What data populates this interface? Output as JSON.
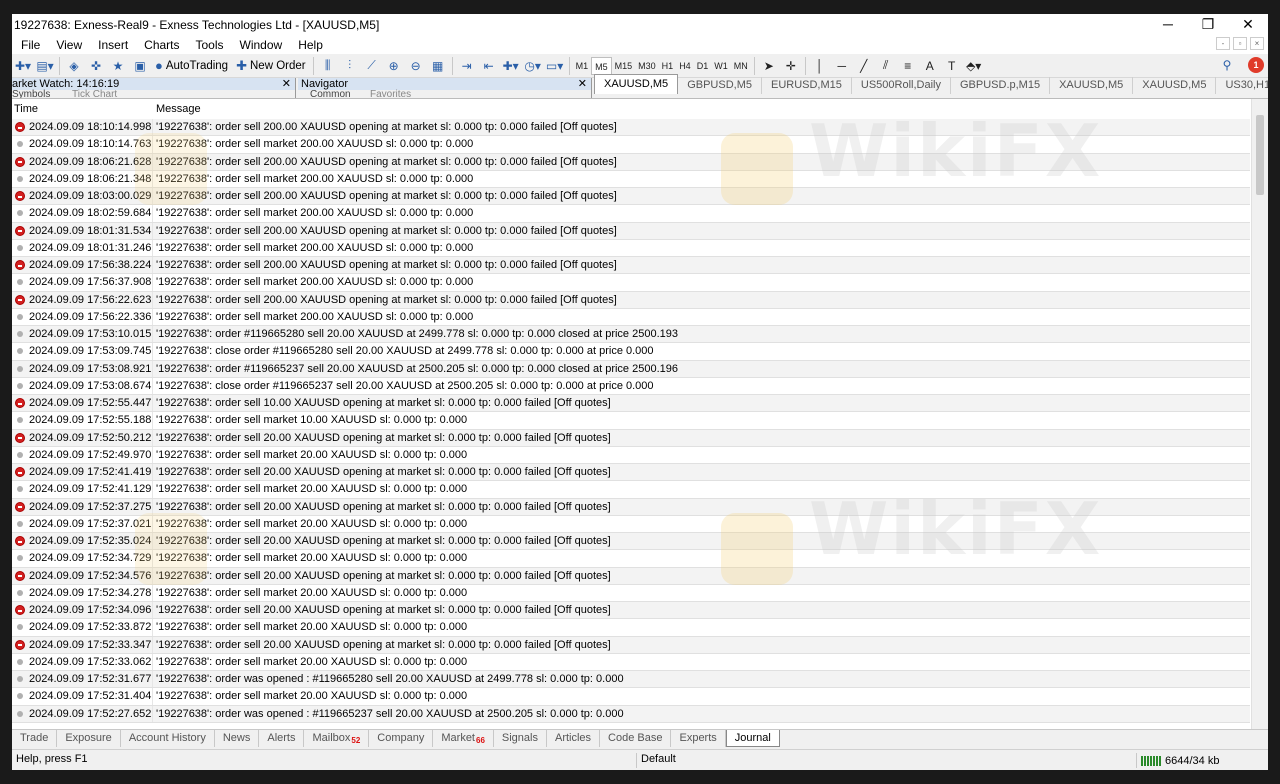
{
  "window": {
    "title": "19227638: Exness-Real9 - Exness Technologies Ltd - [XAUUSD,M5]",
    "controls": {
      "minimize": "─",
      "restore": "❐",
      "close": "✕"
    }
  },
  "menu": [
    "File",
    "View",
    "Insert",
    "Charts",
    "Tools",
    "Window",
    "Help"
  ],
  "toolbar": {
    "autotrading_label": "AutoTrading",
    "new_order_label": "New Order",
    "timeframes": [
      "M1",
      "M5",
      "M15",
      "M30",
      "H1",
      "H4",
      "D1",
      "W1",
      "MN"
    ],
    "selected_timeframe": "M5",
    "notification_count": "1"
  },
  "market_watch": {
    "title": "arket Watch: 14:16:19",
    "tabs": [
      "Symbols",
      "Tick Chart"
    ]
  },
  "navigator": {
    "title": "Navigator",
    "tabs": [
      "Common",
      "Favorites"
    ]
  },
  "chart_tabs": [
    "XAUUSD,M5",
    "GBPUSD,M5",
    "EURUSD,M15",
    "US500Roll,Daily",
    "GBPUSD.p,M15",
    "XAUUSD,M5",
    "XAUUSD,M5",
    "US30,H1",
    "U"
  ],
  "journal": {
    "columns": {
      "time": "Time",
      "message": "Message"
    },
    "rows": [
      {
        "type": "err",
        "time": "2024.09.09 18:10:14.998",
        "msg": "'19227638': order sell 200.00 XAUUSD opening at market sl: 0.000 tp: 0.000 failed [Off quotes]"
      },
      {
        "type": "info",
        "time": "2024.09.09 18:10:14.763",
        "msg": "'19227638': order sell market 200.00 XAUUSD sl: 0.000 tp: 0.000"
      },
      {
        "type": "err",
        "time": "2024.09.09 18:06:21.628",
        "msg": "'19227638': order sell 200.00 XAUUSD opening at market sl: 0.000 tp: 0.000 failed [Off quotes]"
      },
      {
        "type": "info",
        "time": "2024.09.09 18:06:21.348",
        "msg": "'19227638': order sell market 200.00 XAUUSD sl: 0.000 tp: 0.000"
      },
      {
        "type": "err",
        "time": "2024.09.09 18:03:00.029",
        "msg": "'19227638': order sell 200.00 XAUUSD opening at market sl: 0.000 tp: 0.000 failed [Off quotes]"
      },
      {
        "type": "info",
        "time": "2024.09.09 18:02:59.684",
        "msg": "'19227638': order sell market 200.00 XAUUSD sl: 0.000 tp: 0.000"
      },
      {
        "type": "err",
        "time": "2024.09.09 18:01:31.534",
        "msg": "'19227638': order sell 200.00 XAUUSD opening at market sl: 0.000 tp: 0.000 failed [Off quotes]"
      },
      {
        "type": "info",
        "time": "2024.09.09 18:01:31.246",
        "msg": "'19227638': order sell market 200.00 XAUUSD sl: 0.000 tp: 0.000"
      },
      {
        "type": "err",
        "time": "2024.09.09 17:56:38.224",
        "msg": "'19227638': order sell 200.00 XAUUSD opening at market sl: 0.000 tp: 0.000 failed [Off quotes]"
      },
      {
        "type": "info",
        "time": "2024.09.09 17:56:37.908",
        "msg": "'19227638': order sell market 200.00 XAUUSD sl: 0.000 tp: 0.000"
      },
      {
        "type": "err",
        "time": "2024.09.09 17:56:22.623",
        "msg": "'19227638': order sell 200.00 XAUUSD opening at market sl: 0.000 tp: 0.000 failed [Off quotes]"
      },
      {
        "type": "info",
        "time": "2024.09.09 17:56:22.336",
        "msg": "'19227638': order sell market 200.00 XAUUSD sl: 0.000 tp: 0.000"
      },
      {
        "type": "info",
        "time": "2024.09.09 17:53:10.015",
        "msg": "'19227638': order #119665280 sell 20.00 XAUUSD at 2499.778 sl: 0.000 tp: 0.000 closed at price 2500.193"
      },
      {
        "type": "info",
        "time": "2024.09.09 17:53:09.745",
        "msg": "'19227638': close order #119665280 sell 20.00 XAUUSD at 2499.778 sl: 0.000 tp: 0.000 at price 0.000"
      },
      {
        "type": "info",
        "time": "2024.09.09 17:53:08.921",
        "msg": "'19227638': order #119665237 sell 20.00 XAUUSD at 2500.205 sl: 0.000 tp: 0.000 closed at price 2500.196"
      },
      {
        "type": "info",
        "time": "2024.09.09 17:53:08.674",
        "msg": "'19227638': close order #119665237 sell 20.00 XAUUSD at 2500.205 sl: 0.000 tp: 0.000 at price 0.000"
      },
      {
        "type": "err",
        "time": "2024.09.09 17:52:55.447",
        "msg": "'19227638': order sell 10.00 XAUUSD opening at market sl: 0.000 tp: 0.000 failed [Off quotes]"
      },
      {
        "type": "info",
        "time": "2024.09.09 17:52:55.188",
        "msg": "'19227638': order sell market 10.00 XAUUSD sl: 0.000 tp: 0.000"
      },
      {
        "type": "err",
        "time": "2024.09.09 17:52:50.212",
        "msg": "'19227638': order sell 20.00 XAUUSD opening at market sl: 0.000 tp: 0.000 failed [Off quotes]"
      },
      {
        "type": "info",
        "time": "2024.09.09 17:52:49.970",
        "msg": "'19227638': order sell market 20.00 XAUUSD sl: 0.000 tp: 0.000"
      },
      {
        "type": "err",
        "time": "2024.09.09 17:52:41.419",
        "msg": "'19227638': order sell 20.00 XAUUSD opening at market sl: 0.000 tp: 0.000 failed [Off quotes]"
      },
      {
        "type": "info",
        "time": "2024.09.09 17:52:41.129",
        "msg": "'19227638': order sell market 20.00 XAUUSD sl: 0.000 tp: 0.000"
      },
      {
        "type": "err",
        "time": "2024.09.09 17:52:37.275",
        "msg": "'19227638': order sell 20.00 XAUUSD opening at market sl: 0.000 tp: 0.000 failed [Off quotes]"
      },
      {
        "type": "info",
        "time": "2024.09.09 17:52:37.021",
        "msg": "'19227638': order sell market 20.00 XAUUSD sl: 0.000 tp: 0.000"
      },
      {
        "type": "err",
        "time": "2024.09.09 17:52:35.024",
        "msg": "'19227638': order sell 20.00 XAUUSD opening at market sl: 0.000 tp: 0.000 failed [Off quotes]"
      },
      {
        "type": "info",
        "time": "2024.09.09 17:52:34.729",
        "msg": "'19227638': order sell market 20.00 XAUUSD sl: 0.000 tp: 0.000"
      },
      {
        "type": "err",
        "time": "2024.09.09 17:52:34.576",
        "msg": "'19227638': order sell 20.00 XAUUSD opening at market sl: 0.000 tp: 0.000 failed [Off quotes]"
      },
      {
        "type": "info",
        "time": "2024.09.09 17:52:34.278",
        "msg": "'19227638': order sell market 20.00 XAUUSD sl: 0.000 tp: 0.000"
      },
      {
        "type": "err",
        "time": "2024.09.09 17:52:34.096",
        "msg": "'19227638': order sell 20.00 XAUUSD opening at market sl: 0.000 tp: 0.000 failed [Off quotes]"
      },
      {
        "type": "info",
        "time": "2024.09.09 17:52:33.872",
        "msg": "'19227638': order sell market 20.00 XAUUSD sl: 0.000 tp: 0.000"
      },
      {
        "type": "err",
        "time": "2024.09.09 17:52:33.347",
        "msg": "'19227638': order sell 20.00 XAUUSD opening at market sl: 0.000 tp: 0.000 failed [Off quotes]"
      },
      {
        "type": "info",
        "time": "2024.09.09 17:52:33.062",
        "msg": "'19227638': order sell market 20.00 XAUUSD sl: 0.000 tp: 0.000"
      },
      {
        "type": "info",
        "time": "2024.09.09 17:52:31.677",
        "msg": "'19227638': order was opened : #119665280 sell 20.00 XAUUSD at 2499.778 sl: 0.000 tp: 0.000"
      },
      {
        "type": "info",
        "time": "2024.09.09 17:52:31.404",
        "msg": "'19227638': order sell market 20.00 XAUUSD sl: 0.000 tp: 0.000"
      },
      {
        "type": "info",
        "time": "2024.09.09 17:52:27.652",
        "msg": "'19227638': order was opened : #119665237 sell 20.00 XAUUSD at 2500.205 sl: 0.000 tp: 0.000"
      }
    ]
  },
  "watermark": "WikiFX",
  "bottom_tabs": [
    {
      "label": "Trade"
    },
    {
      "label": "Exposure"
    },
    {
      "label": "Account History"
    },
    {
      "label": "News"
    },
    {
      "label": "Alerts"
    },
    {
      "label": "Mailbox",
      "badge": "52"
    },
    {
      "label": "Company"
    },
    {
      "label": "Market",
      "badge": "66"
    },
    {
      "label": "Signals"
    },
    {
      "label": "Articles"
    },
    {
      "label": "Code Base"
    },
    {
      "label": "Experts"
    },
    {
      "label": "Journal",
      "active": true
    }
  ],
  "status": {
    "help": "Help, press F1",
    "profile": "Default",
    "traffic": "6644/34 kb"
  },
  "colors": {
    "error_icon": "#d32020",
    "info_icon": "#b0b0b0",
    "panel_header": "#d7e3f2",
    "badge": "#d11111"
  }
}
